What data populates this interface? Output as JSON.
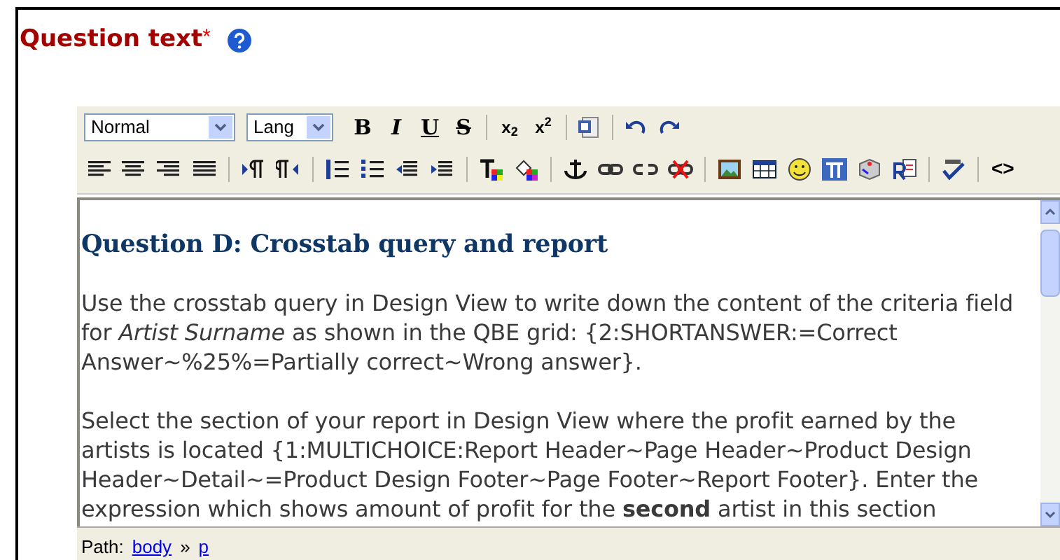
{
  "title": "Question text",
  "required_mark": "*",
  "toolbar": {
    "format_select": "Normal",
    "lang_select": "Lang",
    "style_glyphs": [
      "B",
      "I",
      "U",
      "S"
    ],
    "script_glyphs": [
      "x$_{2}$",
      "x$^{2}$"
    ],
    "html_glyph": "<>"
  },
  "content": {
    "heading": "Question D: Crosstab query and report",
    "paragraphs": [
      "Use the crosstab query in Design View to write down the content of the criteria field for *Artist Surname* as shown in the QBE grid: {2:SHORTANSWER:=Correct Answer~%25%=Partially correct~Wrong answer}.",
      "Select the section of your report in Design View where the profit earned by the artists is located {1:MULTICHOICE:Report Header~Page Header~Product Design Header~Detail~=Product Design Footer~Page Footer~Report Footer}. Enter the expression which shows amount of profit for the **second** artist in this section"
    ]
  },
  "path_bar": {
    "label": "Path:",
    "separator": "»",
    "items": [
      "body",
      "p"
    ]
  }
}
